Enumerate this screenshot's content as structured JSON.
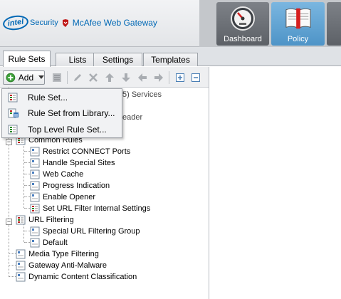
{
  "header": {
    "brand_logo": "intel",
    "brand_security": "Security",
    "product": "McAfee Web Gateway",
    "nav": [
      {
        "label": "Dashboard",
        "icon": "dashboard-gauge-icon"
      },
      {
        "label": "Policy",
        "icon": "policy-book-icon",
        "active": true
      }
    ]
  },
  "tabs": [
    {
      "label": "Rule Sets",
      "active": true
    },
    {
      "label": "Lists"
    },
    {
      "label": "Settings"
    },
    {
      "label": "Templates"
    }
  ],
  "toolbar": {
    "add_label": "Add",
    "icons": [
      "rule-set-icon",
      "edit-icon",
      "delete-icon",
      "move-up-icon",
      "move-down-icon",
      "move-left-icon",
      "move-right-icon",
      "expand-all-icon",
      "collapse-all-icon"
    ]
  },
  "add_menu": [
    {
      "label": "Rule Set..."
    },
    {
      "label": "Rule Set from Library..."
    },
    {
      "label": "Top Level Rule Set..."
    }
  ],
  "tree": {
    "partial_top_1": "5) Services",
    "partial_top_2": "eader",
    "common_rules": {
      "label": "Common Rules",
      "children": [
        "Restrict CONNECT Ports",
        "Handle Special Sites",
        "Web Cache",
        "Progress Indication",
        "Enable Opener",
        "Set URL Filter Internal Settings"
      ]
    },
    "url_filtering": {
      "label": "URL Filtering",
      "children": [
        "Special URL Filtering Group",
        "Default"
      ]
    },
    "top_level": [
      "Media Type Filtering",
      "Gateway Anti-Malware",
      "Dynamic Content Classification"
    ]
  },
  "colors": {
    "brand_blue": "#0068b5",
    "policy_active": "#4e94c7",
    "dashboard_bg": "#5d6167"
  }
}
